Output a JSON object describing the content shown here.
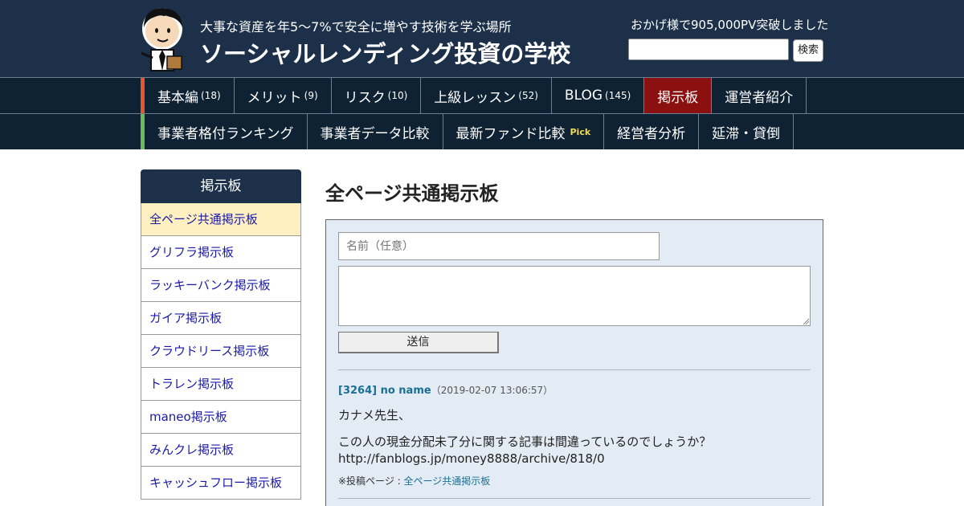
{
  "header": {
    "tagline": "大事な資産を年5～7%で安全に増やす技術を学ぶ場所",
    "title": "ソーシャルレンディング投資の学校",
    "pv_text": "おかげ様で905,000PV突破しました",
    "search_placeholder": "",
    "search_button": "検索"
  },
  "nav": {
    "row1": [
      {
        "label": "基本編",
        "count": "(18)"
      },
      {
        "label": "メリット",
        "count": "(9)"
      },
      {
        "label": "リスク",
        "count": "(10)"
      },
      {
        "label": "上級レッスン",
        "count": "(52)"
      },
      {
        "label": "BLOG",
        "count": "(145)"
      },
      {
        "label": "掲示板",
        "count": ""
      },
      {
        "label": "運営者紹介",
        "count": ""
      }
    ],
    "row2": [
      {
        "label": "事業者格付ランキング",
        "tag": ""
      },
      {
        "label": "事業者データ比較",
        "tag": ""
      },
      {
        "label": "最新ファンド比較",
        "tag": "Pick"
      },
      {
        "label": "経営者分析",
        "tag": ""
      },
      {
        "label": "延滞・貸倒",
        "tag": ""
      }
    ],
    "active": "掲示板"
  },
  "sidebar": {
    "heading": "掲示板",
    "items": [
      "全ページ共通掲示板",
      "グリフラ掲示板",
      "ラッキーバンク掲示板",
      "ガイア掲示板",
      "クラウドリース掲示板",
      "トラレン掲示板",
      "maneo掲示板",
      "みんクレ掲示板",
      "キャッシュフロー掲示板"
    ],
    "active_index": 0
  },
  "main": {
    "title": "全ページ共通掲示板",
    "form": {
      "name_placeholder": "名前（任意）",
      "body_value": "",
      "submit_label": "送信"
    },
    "post": {
      "id_name": "[3264] no name",
      "date": "（2019-02-07 13:06:57）",
      "line1": "カナメ先生、",
      "line2": "この人の現金分配未了分に関する記事は間違っているのでしょうか？",
      "line3": "http://fanblogs.jp/money8888/archive/818/0",
      "meta_prefix": "※投稿ページ : ",
      "meta_link": "全ページ共通掲示板"
    }
  },
  "colors": {
    "header_bg": "#1c3049",
    "nav_bg": "#0f2234",
    "nav_active": "#8b1010",
    "row1_accent": "#e8542c",
    "row2_accent": "#6dbb57",
    "link": "#1a1aa6",
    "board_bg": "#e3ebf4"
  },
  "icons": {
    "logo": "cartoon-teacher-avatar",
    "textarea_resize": "resize-grip-icon"
  }
}
